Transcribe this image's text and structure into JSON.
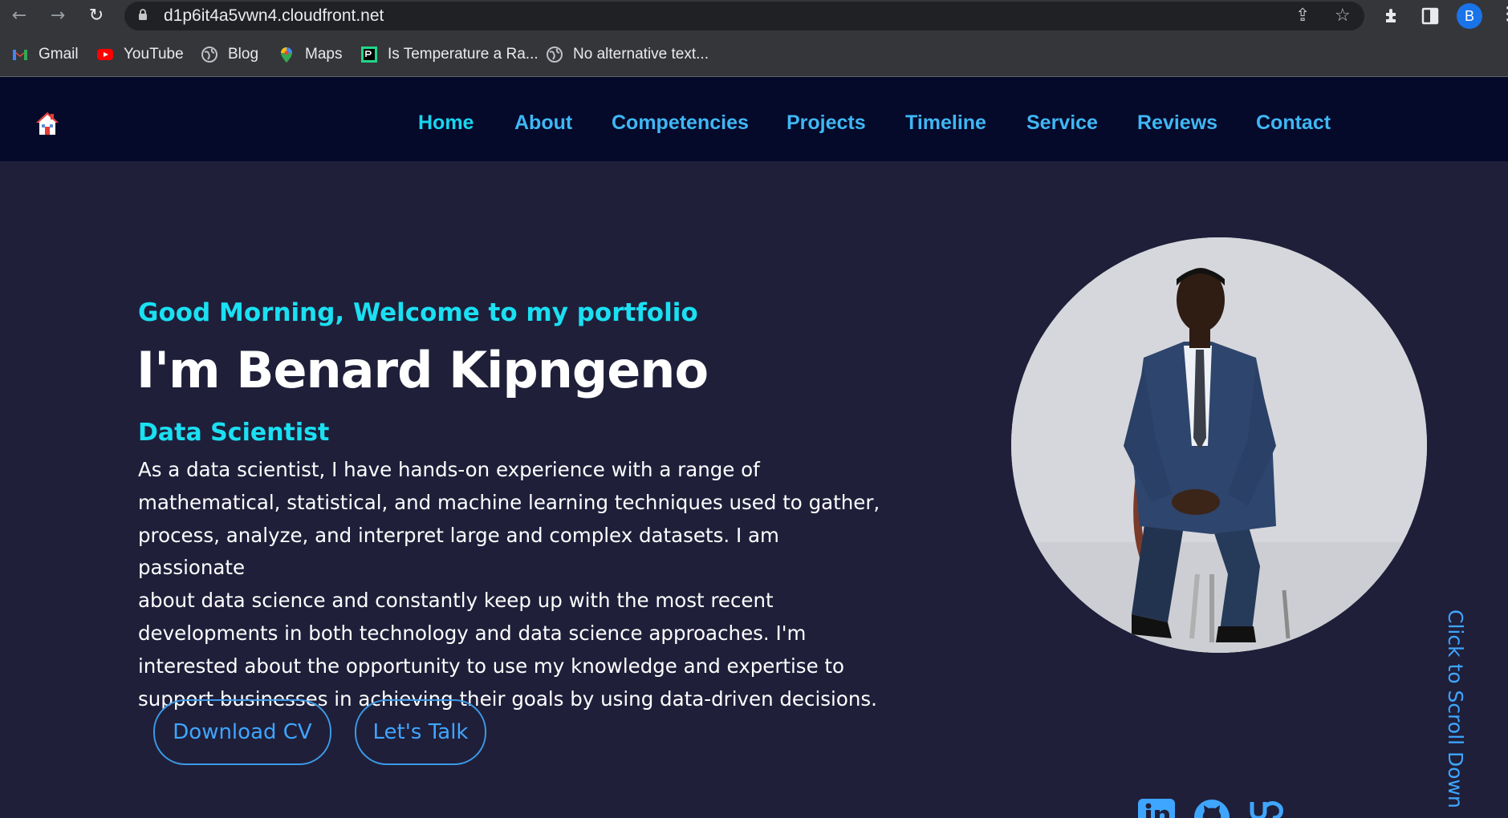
{
  "browser": {
    "url": "d1p6it4a5vwn4.cloudfront.net",
    "profile_initial": "B",
    "bookmarks": [
      {
        "label": "Gmail",
        "icon": "gmail-icon"
      },
      {
        "label": "YouTube",
        "icon": "youtube-icon"
      },
      {
        "label": "Blog",
        "icon": "globe-icon"
      },
      {
        "label": "Maps",
        "icon": "maps-icon"
      },
      {
        "label": "Is Temperature a Ra...",
        "icon": "pycharm-icon"
      },
      {
        "label": "No alternative text...",
        "icon": "globe-icon"
      }
    ]
  },
  "nav": {
    "items": [
      {
        "label": "Home",
        "active": true
      },
      {
        "label": "About"
      },
      {
        "label": "Competencies"
      },
      {
        "label": "Projects"
      },
      {
        "label": "Timeline"
      },
      {
        "label": "Service"
      },
      {
        "label": "Reviews"
      },
      {
        "label": "Contact"
      }
    ]
  },
  "hero": {
    "greeting": "Good Morning, Welcome to my portfolio",
    "name": "I'm Benard Kipngeno",
    "role": "Data Scientist",
    "bio_lines": [
      "As a data scientist, I have hands-on experience with a range of",
      "mathematical, statistical, and machine learning techniques used to gather,",
      "process, analyze, and interpret large and complex datasets. I am passionate",
      "about data science and constantly keep up with the most recent",
      "developments in both technology and data science approaches. I'm",
      "interested about the opportunity to use my knowledge and expertise to",
      "support businesses in achieving their goals by using data-driven decisions."
    ],
    "buttons": {
      "download_cv": "Download CV",
      "lets_talk": "Let's Talk"
    },
    "scroll_hint": "Click to Scroll Down"
  },
  "colors": {
    "page_bg": "#1f1f3a",
    "nav_bg": "#05092a",
    "accent_cyan": "#1ae0f2",
    "nav_link": "#3fb7f4",
    "button_blue": "#3fa6ff"
  }
}
